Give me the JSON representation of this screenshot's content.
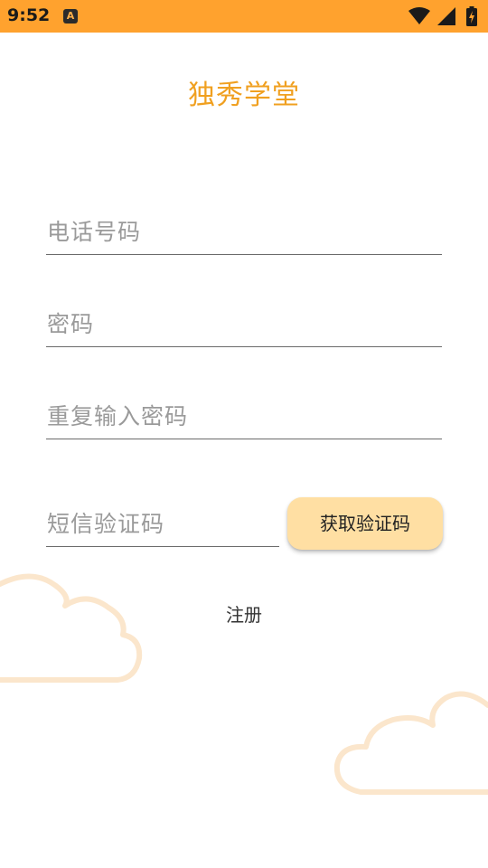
{
  "status_bar": {
    "time": "9:52",
    "notification_icon_letter": "A",
    "background_color": "#FFA22E",
    "icons": [
      "wifi-icon",
      "signal-icon",
      "battery-charging-icon"
    ]
  },
  "app": {
    "title": "独秀学堂",
    "title_color": "#F0A020"
  },
  "form": {
    "phone_placeholder": "电话号码",
    "password_placeholder": "密码",
    "repeat_password_placeholder": "重复输入密码",
    "sms_code_placeholder": "短信验证码",
    "get_code_label": "获取验证码",
    "get_code_color": "#FFDFA3",
    "register_label": "注册"
  },
  "decorations": {
    "cloud_color": "#FBE6CC"
  }
}
